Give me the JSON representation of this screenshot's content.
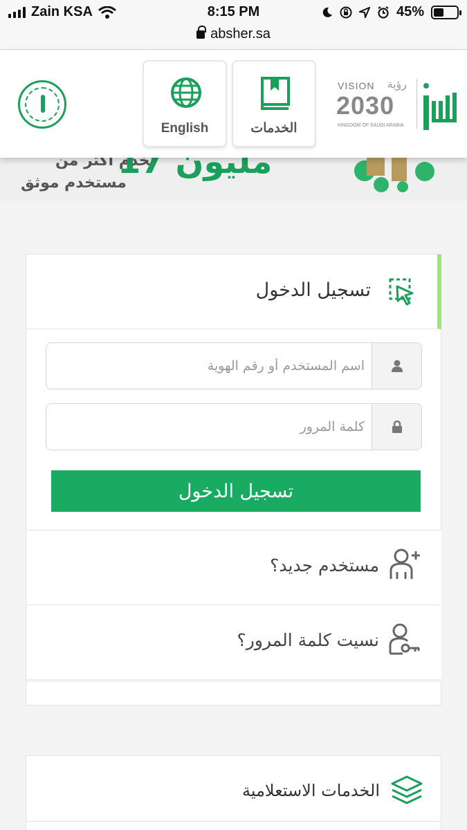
{
  "status_bar": {
    "carrier": "Zain KSA",
    "time": "8:15 PM",
    "battery": "45%",
    "battery_level": 0.45
  },
  "browser": {
    "url": "absher.sa"
  },
  "header": {
    "language_button": "English",
    "services_button": "الخدمات",
    "vision": {
      "label": "VISION",
      "arabic": "رؤية",
      "year": "2030",
      "kingdom": "KINGDOM OF SAUDI ARABIA"
    }
  },
  "banner": {
    "line1": "تخدم أكثر من",
    "number": "17 مليون",
    "line2": "مستخدم موثق"
  },
  "login": {
    "title": "تسجيل الدخول",
    "username_placeholder": "اسم المستخدم أو رقم الهوية",
    "password_placeholder": "كلمة المرور",
    "submit_label": "تسجيل الدخول",
    "new_user": "مستخدم جديد؟",
    "forgot_password": "نسيت كلمة المرور؟"
  },
  "inquiry": {
    "title": "الخدمات الاستعلامية"
  },
  "colors": {
    "brand_green": "#1aab62",
    "accent_light_green": "#9ee47c"
  }
}
